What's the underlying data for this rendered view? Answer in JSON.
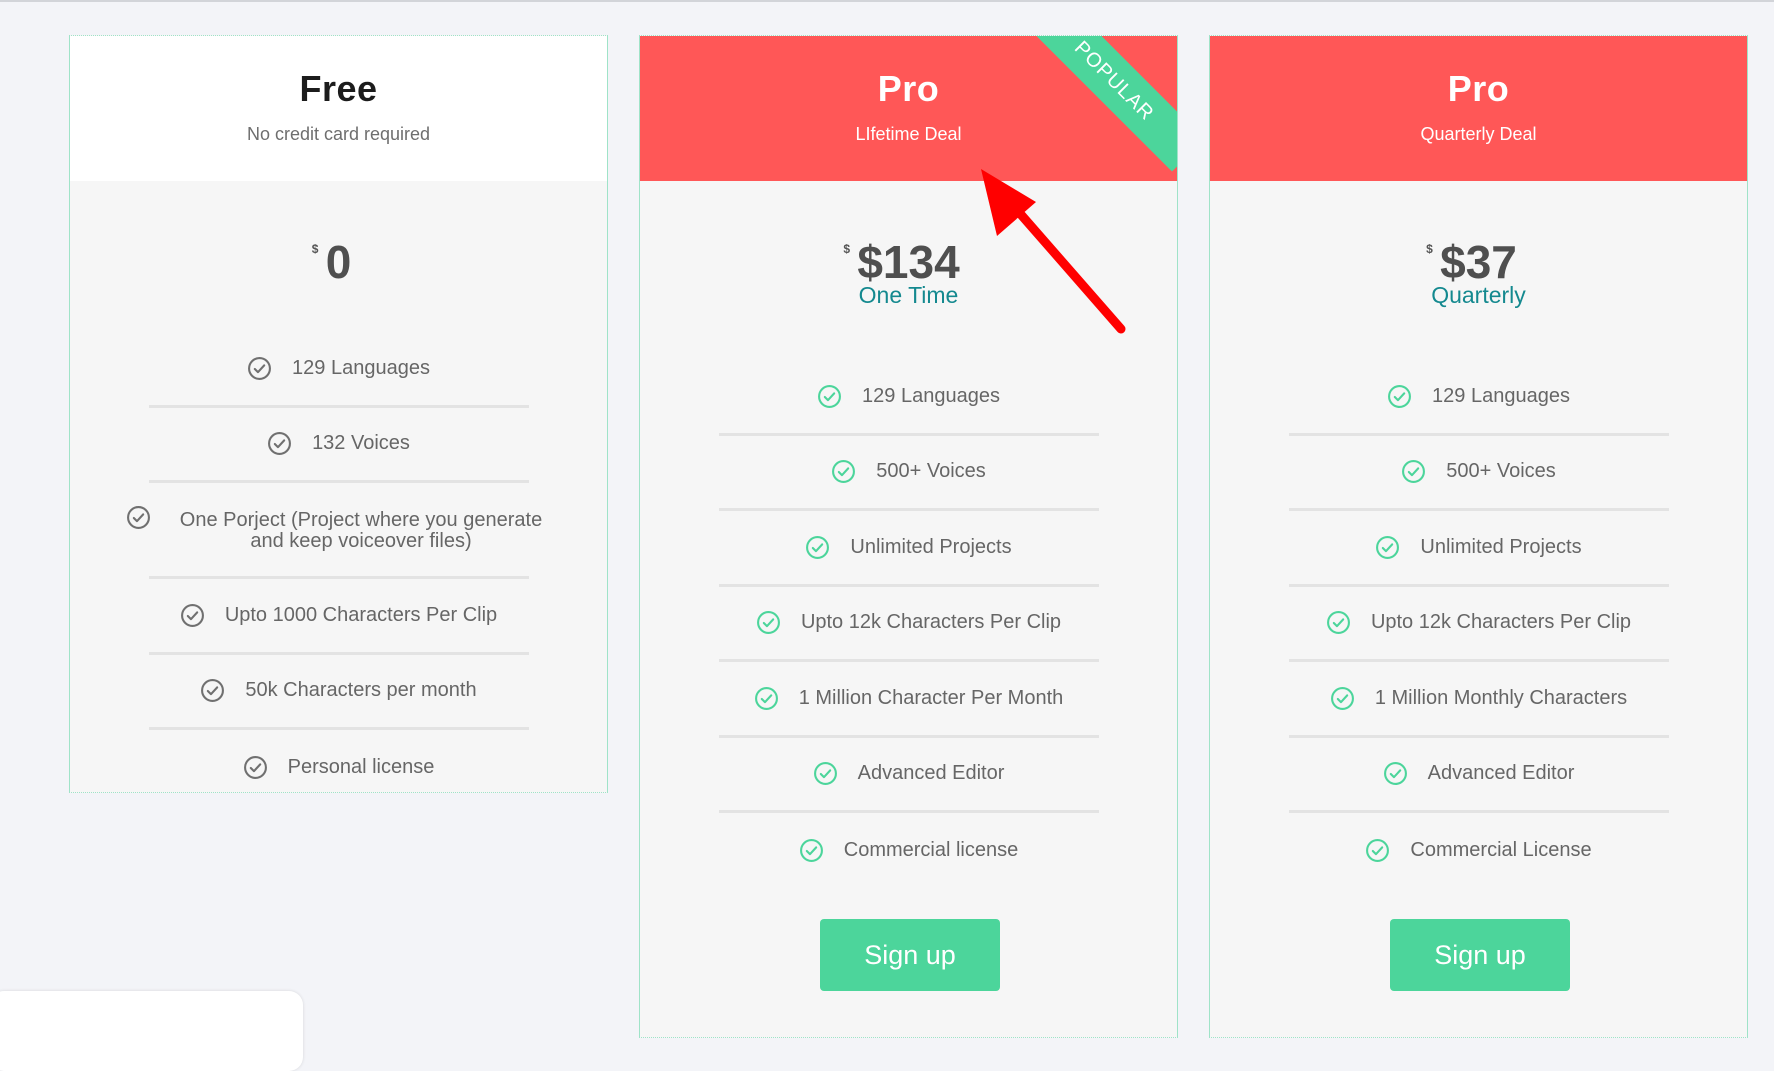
{
  "plans": [
    {
      "title": "Free",
      "subtitle": "No credit card required",
      "currency": "$",
      "price": "0",
      "period": "",
      "features": [
        "129 Languages",
        "132 Voices",
        "One Porject (Project where you generate and keep voiceover files)",
        "Upto 1000 Characters Per Clip",
        "50k Characters per month",
        "Personal license"
      ]
    },
    {
      "title": "Pro",
      "subtitle": "LIfetime Deal",
      "badge": "POPULAR",
      "currency": "$",
      "price": "$134",
      "period": "One Time",
      "features": [
        "129 Languages",
        "500+ Voices",
        "Unlimited Projects",
        "Upto 12k Characters Per Clip",
        "1 Million Character Per Month",
        "Advanced Editor",
        "Commercial license"
      ],
      "cta": "Sign up"
    },
    {
      "title": "Pro",
      "subtitle": "Quarterly Deal",
      "currency": "$",
      "price": "$37",
      "period": "Quarterly",
      "features": [
        "129 Languages",
        "500+ Voices",
        "Unlimited Projects",
        "Upto 12k Characters Per Clip",
        "1 Million Monthly Characters",
        "Advanced Editor",
        "Commercial License"
      ],
      "cta": "Sign up"
    }
  ],
  "colors": {
    "header_accent": "#ff5757",
    "cta_green": "#4cd59b",
    "period_teal": "#14898f",
    "annotation_arrow": "#ff0000"
  },
  "icons": {
    "feature_free": "check-circle-gray",
    "feature_paid": "check-circle-green",
    "annotation": "red-arrow"
  }
}
